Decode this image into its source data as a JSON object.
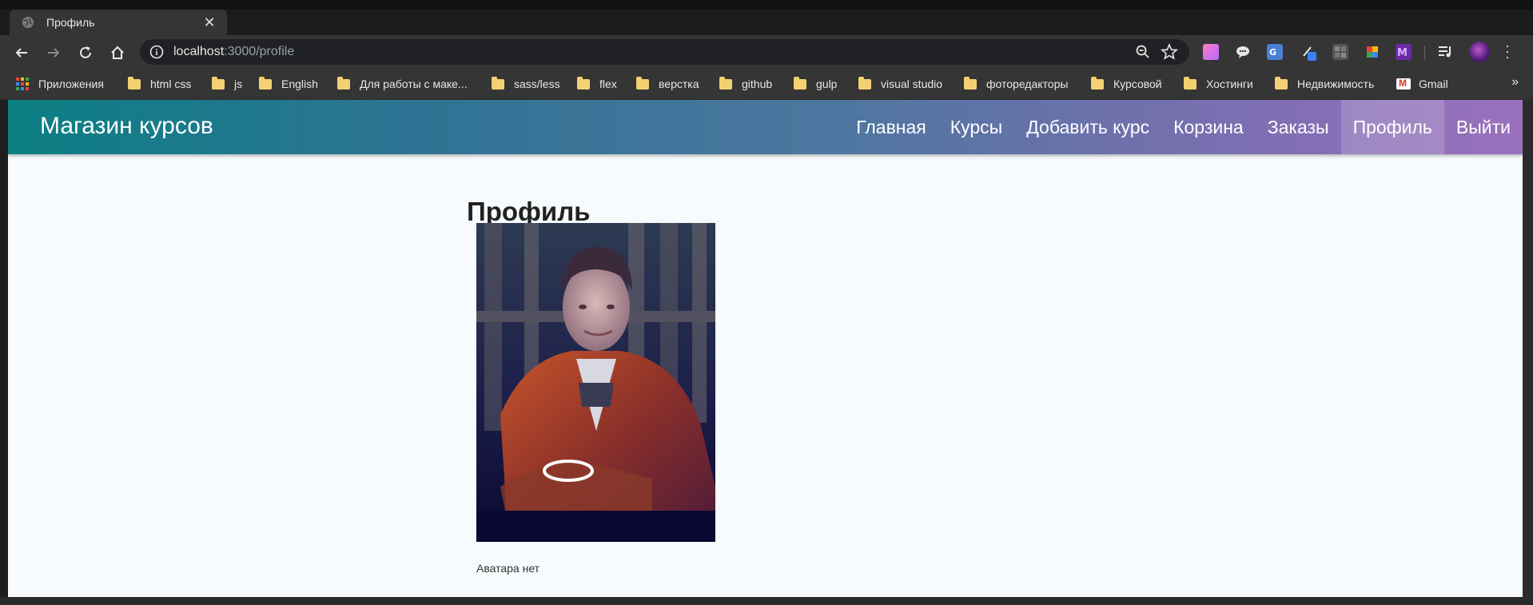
{
  "tab": {
    "title": "Профиль"
  },
  "address": {
    "host": "localhost",
    "path": ":3000/profile"
  },
  "bookmarks": [
    {
      "label": "Приложения",
      "icon": "apps-grid-icon"
    },
    {
      "label": "html css",
      "icon": "folder-icon"
    },
    {
      "label": "js",
      "icon": "folder-icon"
    },
    {
      "label": "English",
      "icon": "folder-icon"
    },
    {
      "label": "Для работы с маке...",
      "icon": "folder-icon"
    },
    {
      "label": "sass/less",
      "icon": "folder-icon"
    },
    {
      "label": "flex",
      "icon": "folder-icon"
    },
    {
      "label": "верстка",
      "icon": "folder-icon"
    },
    {
      "label": "github",
      "icon": "folder-icon"
    },
    {
      "label": "gulp",
      "icon": "folder-icon"
    },
    {
      "label": "visual studio",
      "icon": "folder-icon"
    },
    {
      "label": "фоторедакторы",
      "icon": "folder-icon"
    },
    {
      "label": "Курсовой",
      "icon": "folder-icon"
    },
    {
      "label": "Хостинги",
      "icon": "folder-icon"
    },
    {
      "label": "Недвижимость",
      "icon": "folder-icon"
    },
    {
      "label": "Gmail",
      "icon": "gmail-icon"
    }
  ],
  "bookmarks_more": "»",
  "site": {
    "brand": "Магазин курсов",
    "nav": [
      {
        "label": "Главная",
        "active": false
      },
      {
        "label": "Курсы",
        "active": false
      },
      {
        "label": "Добавить курс",
        "active": false
      },
      {
        "label": "Корзина",
        "active": false
      },
      {
        "label": "Заказы",
        "active": false
      },
      {
        "label": "Профиль",
        "active": true
      },
      {
        "label": "Выйти",
        "active": false
      }
    ]
  },
  "profile": {
    "heading": "Профиль",
    "avatar_caption": "Аватара нет"
  },
  "colors": {
    "navbar_start": "#0b7f83",
    "navbar_end": "#9a70bd",
    "page_bg": "#f7fbfd"
  }
}
